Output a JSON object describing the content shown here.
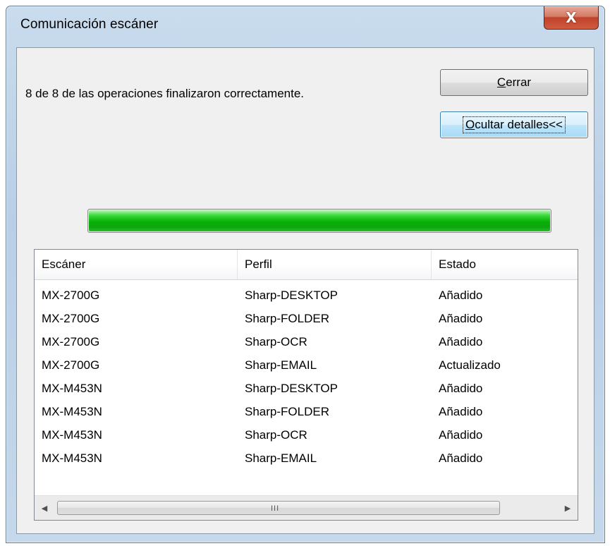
{
  "window": {
    "title": "Comunicación escáner",
    "close_glyph": "X"
  },
  "message": "8 de 8 de las operaciones finalizaron correctamente.",
  "buttons": {
    "close": {
      "accel": "C",
      "rest": "errar"
    },
    "details": {
      "accel": "O",
      "rest": "cultar detalles<<"
    }
  },
  "progress": {
    "value": 1.0,
    "color": "#0cb10c"
  },
  "table": {
    "columns": [
      "Escáner",
      "Perfil",
      "Estado"
    ],
    "rows": [
      [
        "MX-2700G",
        "Sharp-DESKTOP",
        "Añadido"
      ],
      [
        "MX-2700G",
        "Sharp-FOLDER",
        "Añadido"
      ],
      [
        "MX-2700G",
        "Sharp-OCR",
        "Añadido"
      ],
      [
        "MX-2700G",
        "Sharp-EMAIL",
        "Actualizado"
      ],
      [
        "MX-M453N",
        "Sharp-DESKTOP",
        "Añadido"
      ],
      [
        "MX-M453N",
        "Sharp-FOLDER",
        "Añadido"
      ],
      [
        "MX-M453N",
        "Sharp-OCR",
        "Añadido"
      ],
      [
        "MX-M453N",
        "Sharp-EMAIL",
        "Añadido"
      ]
    ]
  },
  "scrollbar": {
    "left_arrow": "◀",
    "right_arrow": "▶",
    "grip": "III"
  }
}
